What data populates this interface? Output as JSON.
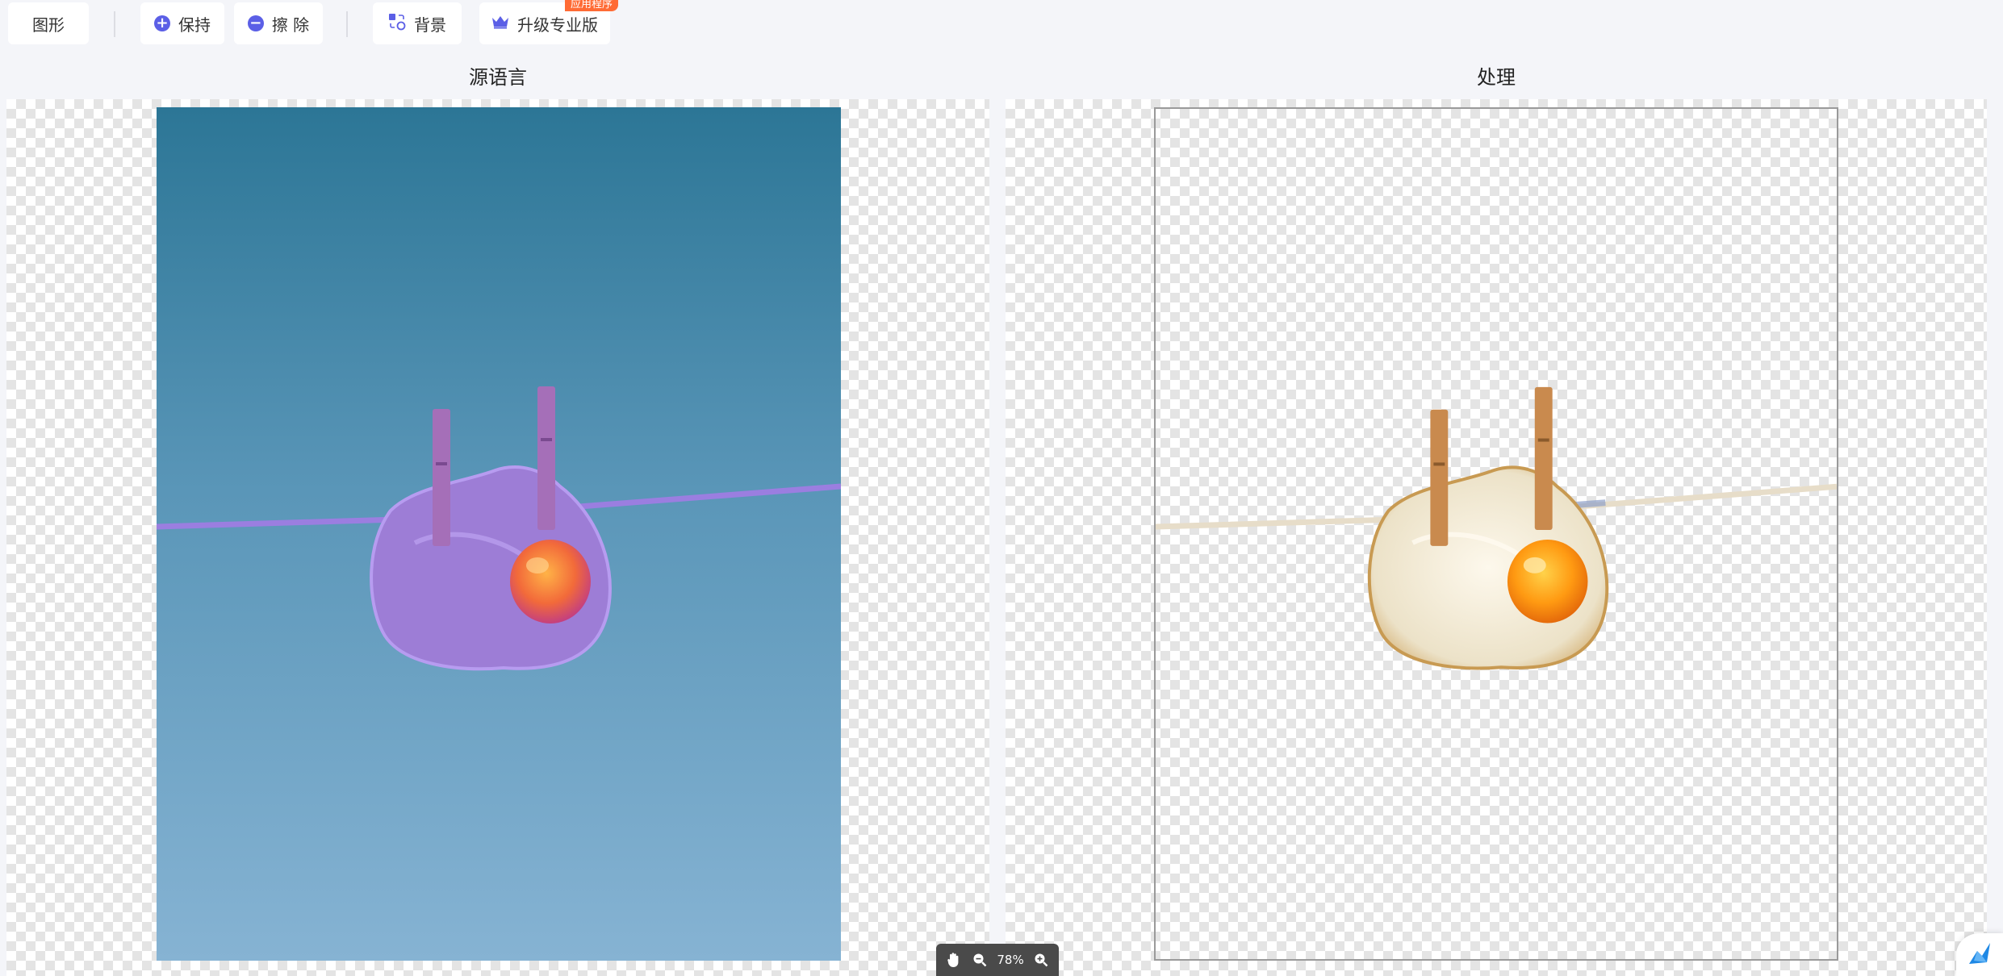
{
  "toolbar": {
    "shape_label": "图形",
    "keep_label": "保持",
    "erase_label": "擦 除",
    "background_label": "背景",
    "upgrade_label": "升级专业版",
    "upgrade_badge": "应用程序"
  },
  "panels": {
    "source_title": "源语言",
    "processed_title": "处理"
  },
  "zoom": {
    "level": "78%"
  },
  "colors": {
    "accent": "#5b5fe6",
    "badge": "#ff6b35"
  }
}
